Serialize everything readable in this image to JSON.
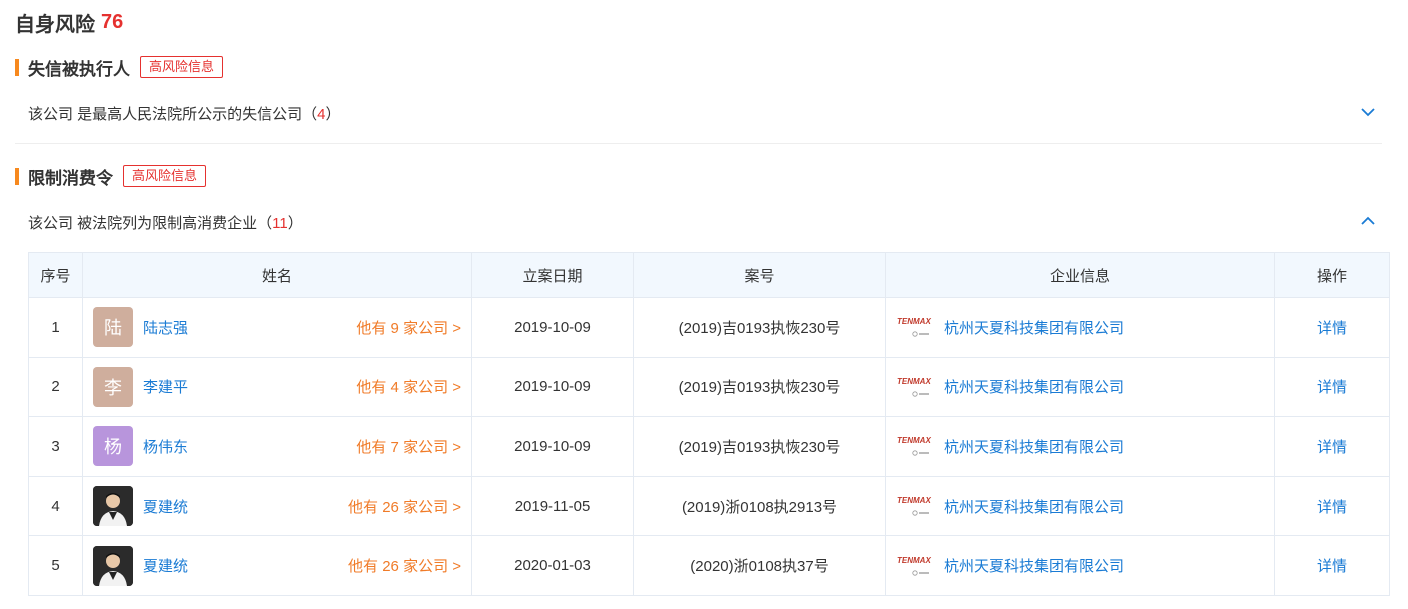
{
  "header": {
    "title": "自身风险",
    "score": "76"
  },
  "sections": [
    {
      "title": "失信被执行人",
      "badge": "高风险信息",
      "summary_prefix": "该公司 是最高人民法院所公示的失信公司（",
      "count": "4",
      "summary_suffix": "）",
      "expanded": false
    },
    {
      "title": "限制消费令",
      "badge": "高风险信息",
      "summary_prefix": "该公司 被法院列为限制高消费企业（",
      "count": "11",
      "summary_suffix": "）",
      "expanded": true
    }
  ],
  "table": {
    "headers": [
      "序号",
      "姓名",
      "立案日期",
      "案号",
      "企业信息",
      "操作"
    ],
    "rows": [
      {
        "index": "1",
        "avatar_char": "陆",
        "avatar_color": "#cfae9d",
        "name": "陆志强",
        "companies": "他有 9 家公司 >",
        "date": "2019-10-09",
        "case_no": "(2019)吉0193执恢230号",
        "company": "杭州天夏科技集团有限公司",
        "action": "详情"
      },
      {
        "index": "2",
        "avatar_char": "李",
        "avatar_color": "#cfae9d",
        "name": "李建平",
        "companies": "他有 4 家公司 >",
        "date": "2019-10-09",
        "case_no": "(2019)吉0193执恢230号",
        "company": "杭州天夏科技集团有限公司",
        "action": "详情"
      },
      {
        "index": "3",
        "avatar_char": "杨",
        "avatar_color": "#b895dc",
        "name": "杨伟东",
        "companies": "他有 7 家公司 >",
        "date": "2019-10-09",
        "case_no": "(2019)吉0193执恢230号",
        "company": "杭州天夏科技集团有限公司",
        "action": "详情"
      },
      {
        "index": "4",
        "avatar_char": "",
        "avatar_color": "#2b2b2b",
        "name": "夏建统",
        "companies": "他有 26 家公司 >",
        "date": "2019-11-05",
        "case_no": "(2019)浙0108执2913号",
        "company": "杭州天夏科技集团有限公司",
        "action": "详情"
      },
      {
        "index": "5",
        "avatar_char": "",
        "avatar_color": "#2b2b2b",
        "name": "夏建统",
        "companies": "他有 26 家公司 >",
        "date": "2020-01-03",
        "case_no": "(2020)浙0108执37号",
        "company": "杭州天夏科技集团有限公司",
        "action": "详情"
      }
    ]
  },
  "colors": {
    "accent": "#f7891e",
    "risk": "#e5312f",
    "link": "#1a7bd4",
    "count": "#f07b28"
  }
}
